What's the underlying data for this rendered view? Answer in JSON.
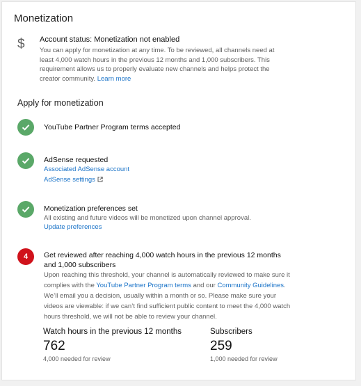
{
  "header": {
    "title": "Monetization"
  },
  "account_status": {
    "icon": "dollar-icon",
    "title": "Account status: Monetization not enabled",
    "description": "You can apply for monetization at any time. To be reviewed, all channels need at least 4,000 watch hours in the previous 12 months and 1,000 subscribers. This requirement allows us to properly evaluate new channels and helps protect the creator community.",
    "learn_more": "Learn more"
  },
  "apply": {
    "heading": "Apply for monetization",
    "steps": [
      {
        "status": "done",
        "icon": "check-icon",
        "title": "YouTube Partner Program terms accepted"
      },
      {
        "status": "done",
        "icon": "check-icon",
        "title": "AdSense requested",
        "links": [
          "Associated AdSense account",
          "AdSense settings"
        ]
      },
      {
        "status": "done",
        "icon": "check-icon",
        "title": "Monetization preferences set",
        "description": "All existing and future videos will be monetized upon channel approval.",
        "links": [
          "Update preferences"
        ]
      },
      {
        "status": "pending",
        "number": "4",
        "title": "Get reviewed after reaching 4,000 watch hours in the previous 12 months and 1,000 subscribers",
        "description_part1": "Upon reaching this threshold, your channel is automatically reviewed to make sure it complies with the",
        "link_terms": "YouTube Partner Program terms",
        "description_and": "and our",
        "link_guidelines": "Community Guidelines",
        "description_part2": ". We’ll email you a decision, usually within a month or so. Please make sure your videos are viewable: if we can’t find sufficient public content to meet the 4,000 watch hours threshold, we will not be able to review your channel."
      }
    ]
  },
  "stats": {
    "watch_hours": {
      "label": "Watch hours in the previous 12 months",
      "value": "762",
      "needed": "4,000 needed for review"
    },
    "subscribers": {
      "label": "Subscribers",
      "value": "259",
      "needed": "1,000 needed for review"
    }
  },
  "colors": {
    "done": "#5aa868",
    "pending": "#d0121b",
    "link": "#1a73c8"
  }
}
